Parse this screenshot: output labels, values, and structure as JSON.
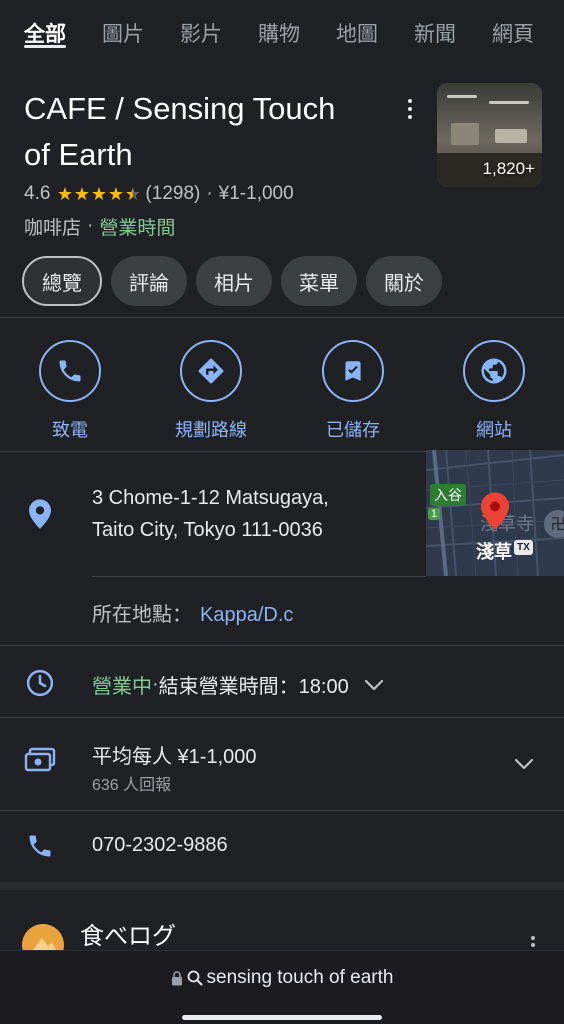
{
  "top_tabs": [
    "全部",
    "圖片",
    "影片",
    "購物",
    "地圖",
    "新聞",
    "網頁"
  ],
  "place": {
    "title_line1": "CAFE / Sensing Touch",
    "title_line2": "of Earth",
    "photo_count": "1,820+",
    "rating": "4.6",
    "stars": 4.6,
    "review_count": "(1298)",
    "price_range": "¥1-1,000",
    "category": "咖啡店",
    "hours_link": "營業時間"
  },
  "chips": [
    "總覽",
    "評論",
    "相片",
    "菜單",
    "關於"
  ],
  "actions": {
    "call": "致電",
    "directions": "規劃路線",
    "saved": "已儲存",
    "website": "網站"
  },
  "address": {
    "line1": "3 Chome-1-12 Matsugaya,",
    "line2": "Taito City, Tokyo 111-0036",
    "located_label": "所在地點：",
    "located_value": "Kappa/D.c"
  },
  "map": {
    "label_station": "入谷",
    "label_temple": "淺草寺",
    "label_asakusa": "淺草",
    "label_tx": "TX",
    "route_badge": "1"
  },
  "hours": {
    "status": "營業中",
    "separator": " · ",
    "closes": "結束營業時間：18:00"
  },
  "price": {
    "main": "平均每人 ¥1-1,000",
    "sub": "636 人回報"
  },
  "phone": "070-2302-9886",
  "source": {
    "name": "食べログ"
  },
  "browser": {
    "url": "sensing touch of earth"
  },
  "colors": {
    "accent_blue": "#8ab4f8",
    "open_green": "#81c995",
    "star_yellow": "#fbbc04",
    "map_pin_red": "#ea4335"
  }
}
